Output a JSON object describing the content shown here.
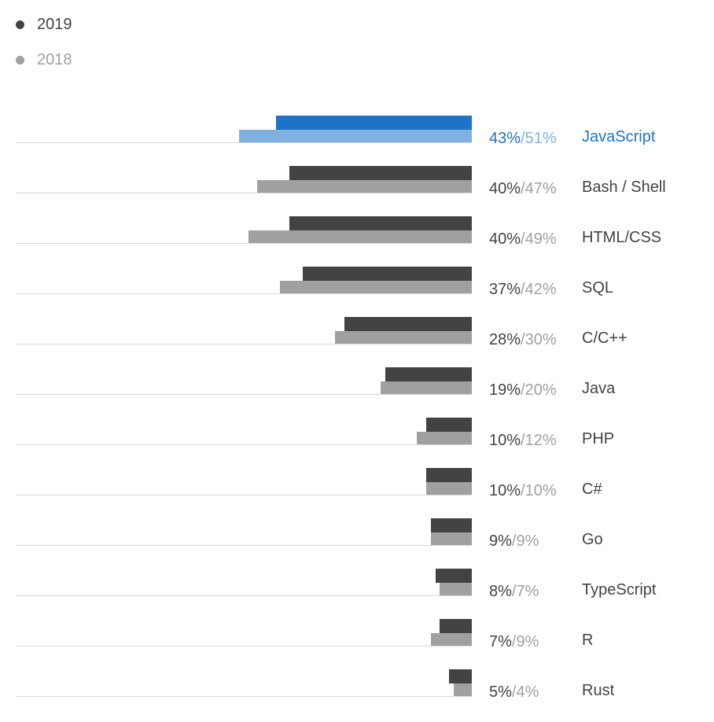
{
  "legend": {
    "y2019": "2019",
    "y2018": "2018"
  },
  "chart_data": {
    "type": "bar",
    "orientation": "horizontal",
    "categories": [
      "JavaScript",
      "Bash / Shell",
      "HTML/CSS",
      "SQL",
      "C/C++",
      "Java",
      "PHP",
      "C#",
      "Go",
      "TypeScript",
      "R",
      "Rust"
    ],
    "series": [
      {
        "name": "2019",
        "values": [
          43,
          40,
          40,
          37,
          28,
          19,
          10,
          10,
          9,
          8,
          7,
          5
        ]
      },
      {
        "name": "2018",
        "values": [
          51,
          47,
          49,
          42,
          30,
          20,
          12,
          10,
          9,
          7,
          9,
          4
        ]
      }
    ],
    "highlight_index": 0,
    "xlim": [
      0,
      100
    ],
    "unit": "%",
    "colors": {
      "2019": "#434343",
      "2018": "#a0a0a0",
      "highlight_2019": "#1e73c9",
      "highlight_2018": "#7fb0e0"
    }
  }
}
